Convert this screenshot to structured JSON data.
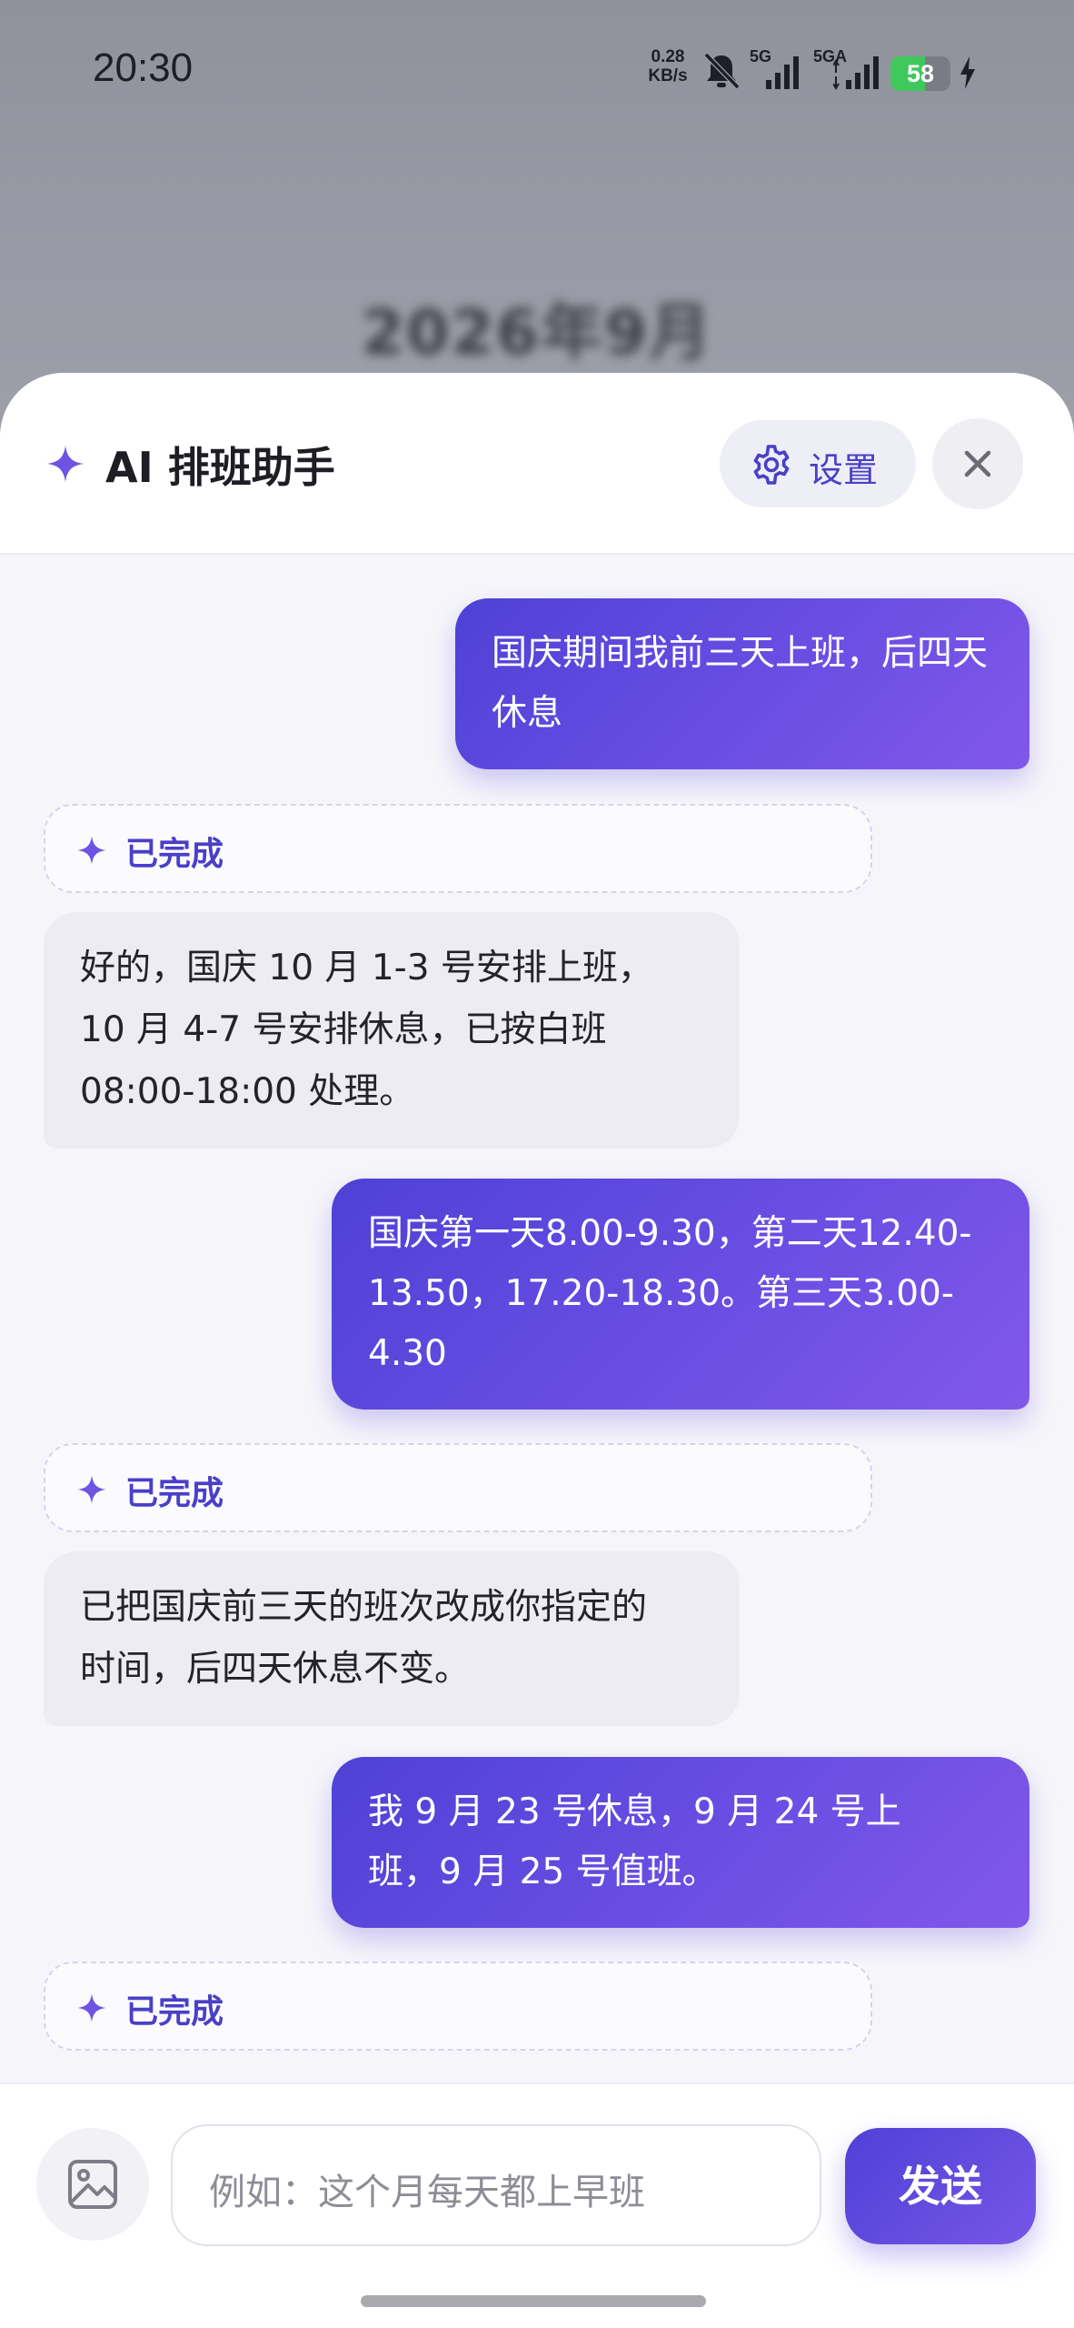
{
  "status_bar": {
    "time": "20:30",
    "net_speed_value": "0.28",
    "net_speed_unit": "KB/s",
    "sim1_label": "5G",
    "sim2_label": "5GA",
    "battery_level": "58",
    "battery_percent": 58
  },
  "background": {
    "month_title": "2026年9月"
  },
  "header": {
    "title": "AI 排班助手",
    "settings_label": "设置",
    "close_icon": "close-icon"
  },
  "messages": [
    {
      "role": "user",
      "text": "国庆期间我前三天上班，后四天休息"
    },
    {
      "role": "status",
      "text": "已完成"
    },
    {
      "role": "ai",
      "lines": [
        "好的，国庆 10 月 1-3 号安排上班，",
        "10 月 4-7 号安排休息，已按白班",
        "08:00-18:00 处理。"
      ]
    },
    {
      "role": "user",
      "lines": [
        "国庆第一天8.00-9.30，第二天12.40-",
        "13.50，17.20-18.30。第三天3.00-",
        "4.30"
      ]
    },
    {
      "role": "status",
      "text": "已完成"
    },
    {
      "role": "ai",
      "lines": [
        "已把国庆前三天的班次改成你指定的",
        "时间，后四天休息不变。"
      ]
    },
    {
      "role": "user",
      "lines": [
        "我 9 月 23 号休息，9 月 24 号上",
        "班，9 月 25 号值班。"
      ]
    },
    {
      "role": "status",
      "text": "已完成"
    }
  ],
  "composer": {
    "placeholder": "例如：这个月每天都上早班",
    "send_label": "发送",
    "image_icon": "image-icon"
  },
  "colors": {
    "accent": "#4f41d6",
    "accent_light": "#8158e9",
    "ai_bubble": "#ececf2"
  }
}
